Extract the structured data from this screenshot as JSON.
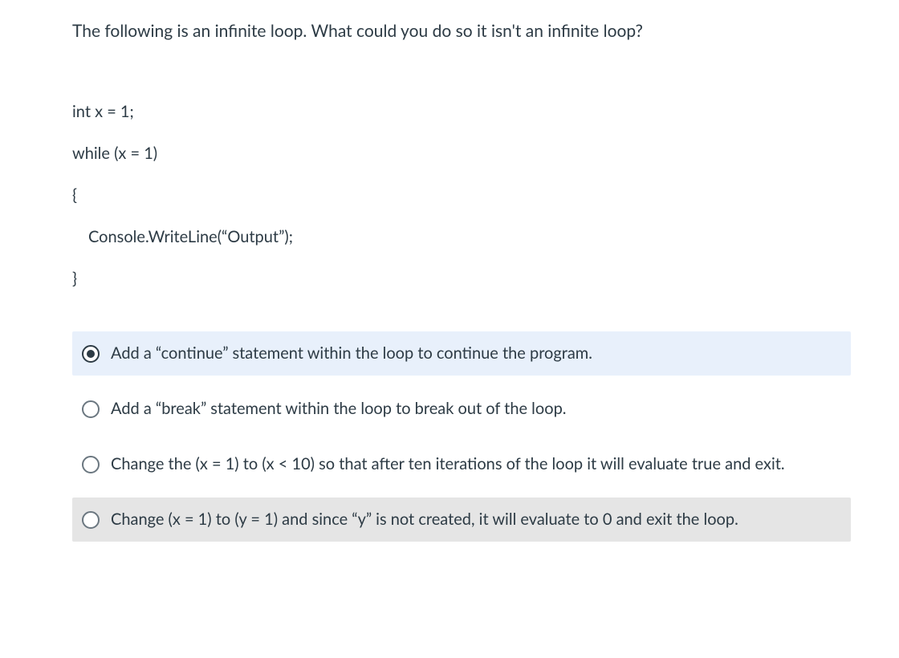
{
  "question": {
    "prompt": "The following is an infinite loop. What could you do so it isn't an infinite loop?",
    "code": {
      "line1": "int x = 1;",
      "line2": "while (x = 1)",
      "line3": "{",
      "line4": "Console.WriteLine(“Output”);",
      "line5": "}"
    }
  },
  "options": [
    {
      "label": "Add a “continue” statement within the loop to continue the program.",
      "selected": true,
      "shaded": false
    },
    {
      "label": "Add a “break” statement within the loop to break out of the loop.",
      "selected": false,
      "shaded": false
    },
    {
      "label": "Change the (x = 1) to (x < 10) so that after ten iterations of the loop it will evaluate true and exit.",
      "selected": false,
      "shaded": false
    },
    {
      "label": "Change (x = 1) to (y = 1) and since “y” is not created, it will evaluate to 0 and exit the loop.",
      "selected": false,
      "shaded": true
    }
  ]
}
